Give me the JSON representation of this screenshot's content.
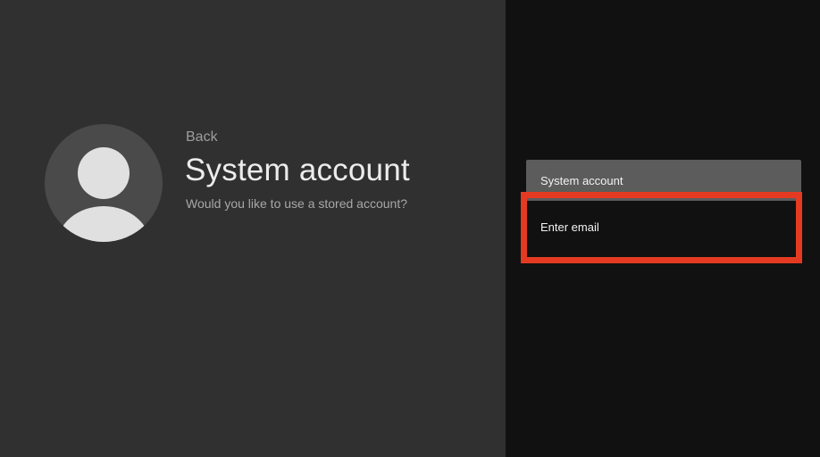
{
  "header": {
    "back_label": "Back",
    "title": "System account",
    "subtitle": "Would you like to use a stored account?"
  },
  "avatar": {
    "icon": "user-avatar-icon"
  },
  "options": [
    {
      "label": "System account"
    },
    {
      "label": "Enter email"
    }
  ],
  "colors": {
    "left_panel_bg": "#303030",
    "right_panel_bg": "#111111",
    "selected_option_bg": "#5c5c5c",
    "highlight": "#e53a22"
  }
}
